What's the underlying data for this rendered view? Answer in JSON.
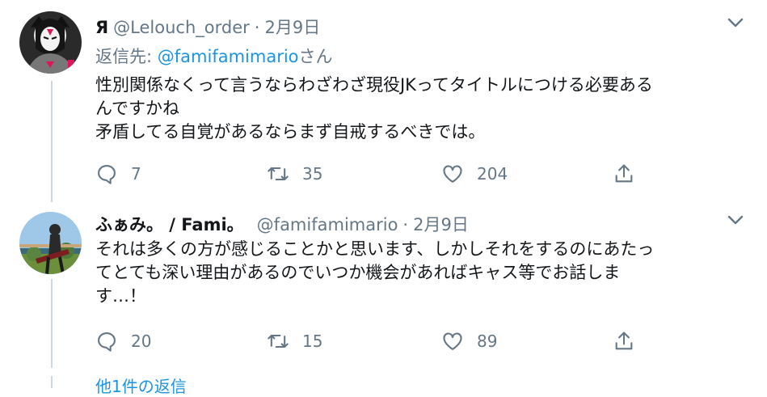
{
  "tweets": [
    {
      "name": "Я",
      "handle": "@Lelouch_order",
      "dot": "·",
      "date": "2月9日",
      "replying": {
        "prefix": "返信先: ",
        "mention": "@famifamimario",
        "suffix": "さん"
      },
      "lines": [
        "性別関係なくって言うならわざわざ現役JKってタイトルにつける必要あるんですかね",
        "矛盾してる自覚があるならまず自戒するべきでは。"
      ],
      "line_break_display": [
        "性別関係なくって言うならわざわざ現役JKってタイトルにつける必要ある",
        "んですかね",
        "矛盾してる自覚があるならまず自戒するべきでは。"
      ],
      "replies": "7",
      "retweets": "35",
      "likes": "204"
    },
    {
      "name": "ふぁみ。 / Fami。",
      "handle": "@famifamimario",
      "dot": "·",
      "date": "2月9日",
      "lines": [
        "それは多くの方が感じることかと思います、しかしそれをするのにあたってとても深い理由があるのでいつか機会があればキャス等でお話します…！"
      ],
      "line_break_display": [
        "それは多くの方が感じることかと思います、しかしそれをするのにあたっ",
        "てとても深い理由があるのでいつか機会があればキャス等でお話しま",
        "す…！"
      ],
      "replies": "20",
      "retweets": "15",
      "likes": "89"
    }
  ],
  "more_replies_link": "他1件の返信",
  "colors": {
    "accent": "#1b95e0",
    "secondary": "#657786",
    "text": "#14171a",
    "thread_line": "#cdd6dc"
  },
  "icons": [
    "chevron-down-icon",
    "reply-icon",
    "retweet-icon",
    "like-icon",
    "share-icon"
  ]
}
